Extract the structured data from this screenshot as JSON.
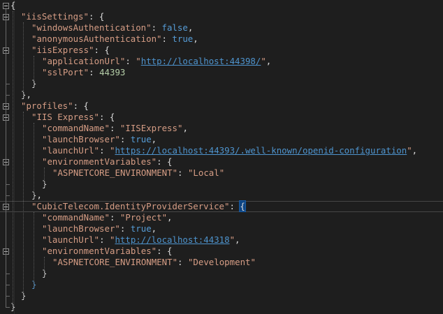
{
  "editor": {
    "lines": [
      {
        "indent": 0,
        "tokens": [
          {
            "t": "p",
            "v": "{"
          }
        ]
      },
      {
        "indent": 1,
        "tokens": [
          {
            "t": "s",
            "v": "\"iisSettings\""
          },
          {
            "t": "p",
            "v": ": {"
          }
        ]
      },
      {
        "indent": 2,
        "tokens": [
          {
            "t": "s",
            "v": "\"windowsAuthentication\""
          },
          {
            "t": "p",
            "v": ": "
          },
          {
            "t": "kw",
            "v": "false"
          },
          {
            "t": "p",
            "v": ","
          }
        ]
      },
      {
        "indent": 2,
        "tokens": [
          {
            "t": "s",
            "v": "\"anonymousAuthentication\""
          },
          {
            "t": "p",
            "v": ": "
          },
          {
            "t": "kw",
            "v": "true"
          },
          {
            "t": "p",
            "v": ","
          }
        ]
      },
      {
        "indent": 2,
        "tokens": [
          {
            "t": "s",
            "v": "\"iisExpress\""
          },
          {
            "t": "p",
            "v": ": {"
          }
        ]
      },
      {
        "indent": 3,
        "tokens": [
          {
            "t": "s",
            "v": "\"applicationUrl\""
          },
          {
            "t": "p",
            "v": ": "
          },
          {
            "t": "s",
            "v": "\""
          },
          {
            "t": "u",
            "v": "http://localhost:44398/"
          },
          {
            "t": "s",
            "v": "\""
          },
          {
            "t": "p",
            "v": ","
          }
        ]
      },
      {
        "indent": 3,
        "tokens": [
          {
            "t": "s",
            "v": "\"sslPort\""
          },
          {
            "t": "p",
            "v": ": "
          },
          {
            "t": "n",
            "v": "44393"
          }
        ]
      },
      {
        "indent": 2,
        "tokens": [
          {
            "t": "p",
            "v": "}"
          }
        ]
      },
      {
        "indent": 1,
        "tokens": [
          {
            "t": "p",
            "v": "},"
          }
        ]
      },
      {
        "indent": 1,
        "tokens": [
          {
            "t": "s",
            "v": "\"profiles\""
          },
          {
            "t": "p",
            "v": ": {"
          }
        ]
      },
      {
        "indent": 2,
        "tokens": [
          {
            "t": "s",
            "v": "\"IIS Express\""
          },
          {
            "t": "p",
            "v": ": {"
          }
        ]
      },
      {
        "indent": 3,
        "tokens": [
          {
            "t": "s",
            "v": "\"commandName\""
          },
          {
            "t": "p",
            "v": ": "
          },
          {
            "t": "s",
            "v": "\"IISExpress\""
          },
          {
            "t": "p",
            "v": ","
          }
        ]
      },
      {
        "indent": 3,
        "tokens": [
          {
            "t": "s",
            "v": "\"launchBrowser\""
          },
          {
            "t": "p",
            "v": ": "
          },
          {
            "t": "kw",
            "v": "true"
          },
          {
            "t": "p",
            "v": ","
          }
        ]
      },
      {
        "indent": 3,
        "tokens": [
          {
            "t": "s",
            "v": "\"launchUrl\""
          },
          {
            "t": "p",
            "v": ": "
          },
          {
            "t": "s",
            "v": "\""
          },
          {
            "t": "u",
            "v": "https://localhost:44393/.well-known/openid-configuration"
          },
          {
            "t": "s",
            "v": "\""
          },
          {
            "t": "p",
            "v": ","
          }
        ]
      },
      {
        "indent": 3,
        "tokens": [
          {
            "t": "s",
            "v": "\"environmentVariables\""
          },
          {
            "t": "p",
            "v": ": {"
          }
        ]
      },
      {
        "indent": 4,
        "tokens": [
          {
            "t": "s",
            "v": "\"ASPNETCORE_ENVIRONMENT\""
          },
          {
            "t": "p",
            "v": ": "
          },
          {
            "t": "s",
            "v": "\"Local\""
          }
        ]
      },
      {
        "indent": 3,
        "tokens": [
          {
            "t": "p",
            "v": "}"
          }
        ]
      },
      {
        "indent": 2,
        "tokens": [
          {
            "t": "p",
            "v": "},"
          }
        ]
      },
      {
        "indent": 2,
        "current": true,
        "tokens": [
          {
            "t": "s",
            "v": "\"CubicTelecom.IdentityProviderService\""
          },
          {
            "t": "p",
            "v": ": "
          },
          {
            "t": "hl",
            "v": "{"
          }
        ]
      },
      {
        "indent": 3,
        "tokens": [
          {
            "t": "s",
            "v": "\"commandName\""
          },
          {
            "t": "p",
            "v": ": "
          },
          {
            "t": "s",
            "v": "\"Project\""
          },
          {
            "t": "p",
            "v": ","
          }
        ]
      },
      {
        "indent": 3,
        "tokens": [
          {
            "t": "s",
            "v": "\"launchBrowser\""
          },
          {
            "t": "p",
            "v": ": "
          },
          {
            "t": "kw",
            "v": "true"
          },
          {
            "t": "p",
            "v": ","
          }
        ]
      },
      {
        "indent": 3,
        "tokens": [
          {
            "t": "s",
            "v": "\"launchUrl\""
          },
          {
            "t": "p",
            "v": ": "
          },
          {
            "t": "s",
            "v": "\""
          },
          {
            "t": "u",
            "v": "http://localhost:44318"
          },
          {
            "t": "s",
            "v": "\""
          },
          {
            "t": "p",
            "v": ","
          }
        ]
      },
      {
        "indent": 3,
        "tokens": [
          {
            "t": "s",
            "v": "\"environmentVariables\""
          },
          {
            "t": "p",
            "v": ": {"
          }
        ]
      },
      {
        "indent": 4,
        "tokens": [
          {
            "t": "s",
            "v": "\"ASPNETCORE_ENVIRONMENT\""
          },
          {
            "t": "p",
            "v": ": "
          },
          {
            "t": "s",
            "v": "\"Development\""
          }
        ]
      },
      {
        "indent": 3,
        "tokens": [
          {
            "t": "p",
            "v": "}"
          }
        ]
      },
      {
        "indent": 2,
        "tokens": [
          {
            "t": "bb",
            "v": "}"
          }
        ]
      },
      {
        "indent": 1,
        "tokens": [
          {
            "t": "p",
            "v": "}"
          }
        ]
      },
      {
        "indent": 0,
        "tokens": [
          {
            "t": "p",
            "v": "}"
          }
        ]
      }
    ]
  },
  "colors": {
    "background": "#1e1e1e",
    "string": "#d69d85",
    "keyword": "#569cd6",
    "number": "#b5cea8",
    "link": "#4e94ce"
  }
}
